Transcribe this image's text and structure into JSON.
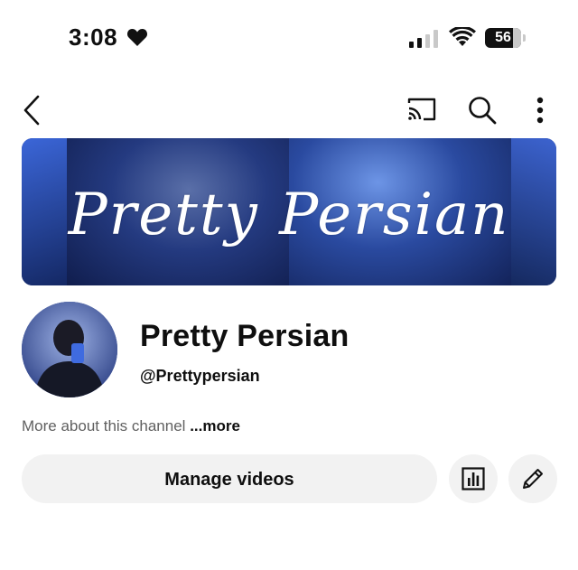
{
  "status_bar": {
    "time": "3:08",
    "battery": "56"
  },
  "channel": {
    "banner_text": "Pretty Persian",
    "name": "Pretty Persian",
    "handle": "@Prettypersian",
    "about_text": "More about this channel",
    "more_label": "...more"
  },
  "actions": {
    "manage_videos_label": "Manage videos"
  },
  "icons": {
    "back": "chevron-left-icon",
    "cast": "cast-icon",
    "search": "search-icon",
    "more": "vertical-dots-icon",
    "analytics": "bar-chart-icon",
    "edit": "pencil-icon"
  },
  "colors": {
    "banner_blue": "#1a2f73",
    "button_bg": "#f2f2f2",
    "muted_text": "#606060"
  }
}
